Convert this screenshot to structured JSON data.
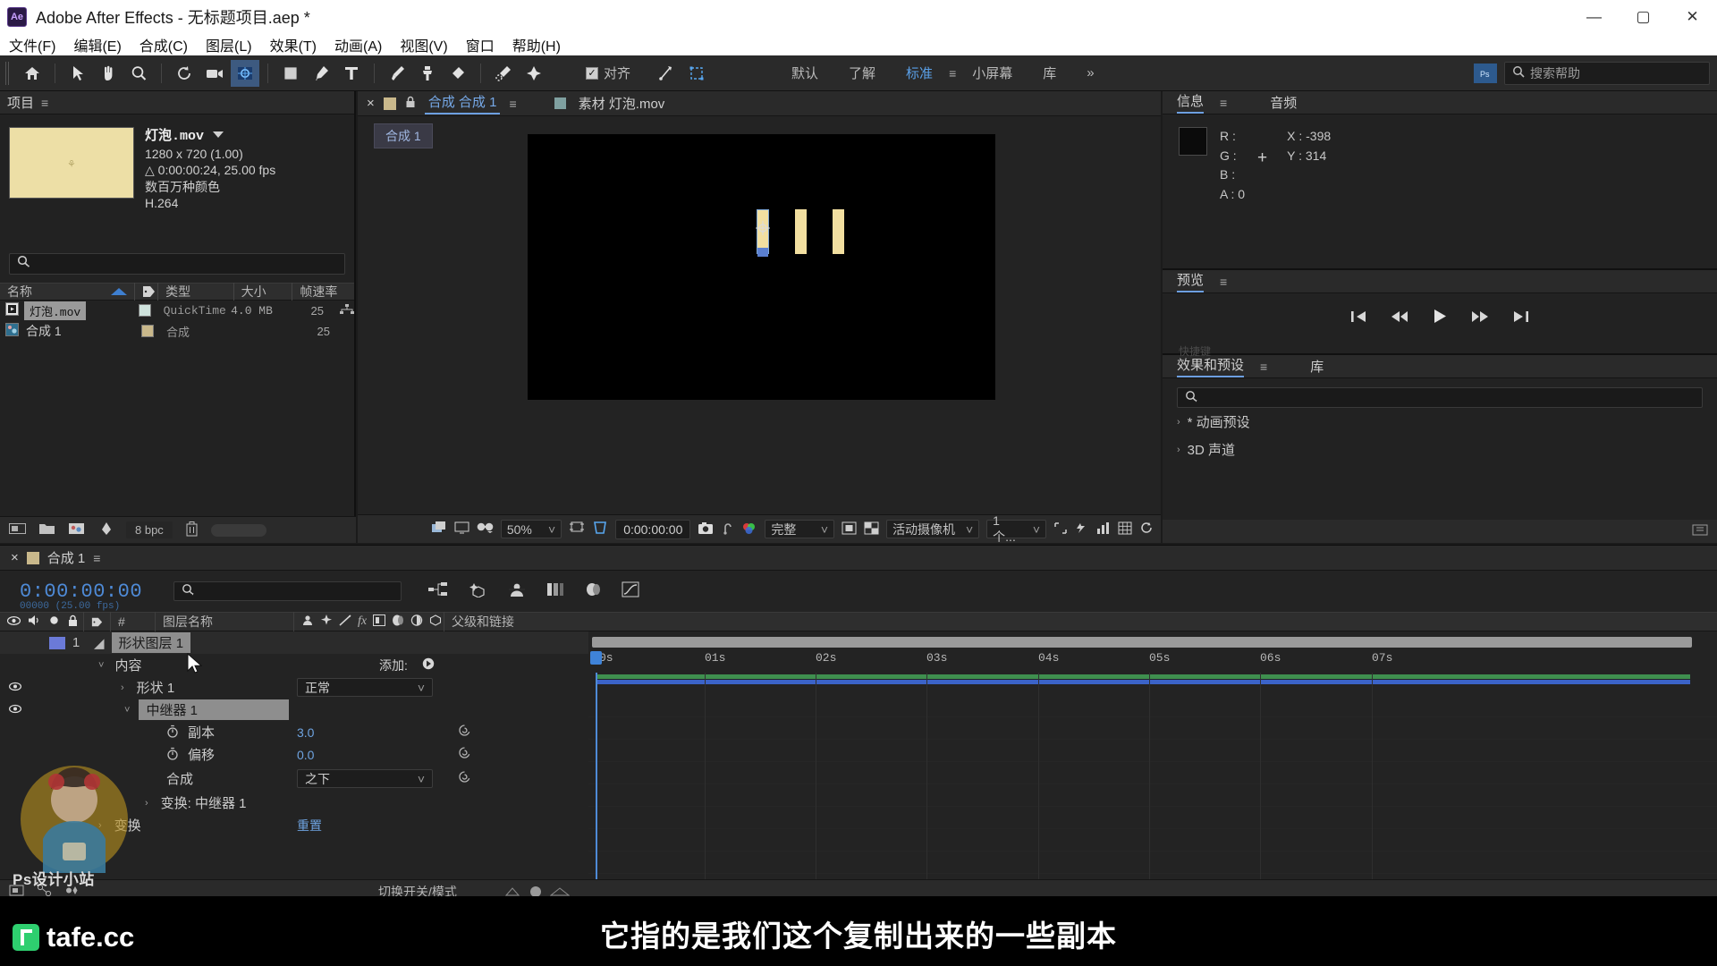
{
  "window": {
    "title": "Adobe After Effects - 无标题项目.aep *",
    "logo": "Ae",
    "minimize": "—",
    "maximize": "▢",
    "close": "✕"
  },
  "menubar": [
    "文件(F)",
    "编辑(E)",
    "合成(C)",
    "图层(L)",
    "效果(T)",
    "动画(A)",
    "视图(V)",
    "窗口",
    "帮助(H)"
  ],
  "toolbar": {
    "tools": [
      {
        "name": "home-icon"
      },
      {
        "name": "selection-tool-icon"
      },
      {
        "name": "hand-tool-icon"
      },
      {
        "name": "zoom-tool-icon"
      },
      {
        "name": "rotation-tool-icon"
      },
      {
        "name": "camera-tool-icon"
      },
      {
        "name": "unified-camera-tool-icon"
      },
      {
        "name": "shape-tool-icon"
      },
      {
        "name": "pen-tool-icon"
      },
      {
        "name": "type-tool-icon"
      },
      {
        "name": "brush-tool-icon"
      },
      {
        "name": "clone-stamp-tool-icon"
      },
      {
        "name": "eraser-tool-icon"
      },
      {
        "name": "roto-brush-tool-icon"
      },
      {
        "name": "puppet-tool-icon"
      }
    ],
    "snap_label": "对齐",
    "snap_checked": "✓",
    "workspaces": [
      "默认",
      "了解",
      "标准",
      "小屏幕",
      "库"
    ],
    "active_workspace": "标准",
    "overflow": "»",
    "search_placeholder": "搜索帮助"
  },
  "project": {
    "tab_label": "项目",
    "menu_icon": "≡",
    "asset": {
      "name": "灯泡.mov",
      "resolution": "1280 x 720 (1.00)",
      "duration": "△ 0:00:00:24, 25.00 fps",
      "colors": "数百万种颜色",
      "codec": "H.264"
    },
    "search_placeholder": "",
    "columns": [
      "名称",
      "类型",
      "大小",
      "帧速率"
    ],
    "rows": [
      {
        "name": "灯泡.mov",
        "type": "QuickTime",
        "size": "4.0 MB",
        "fps": "25",
        "selected": true
      },
      {
        "name": "合成 1",
        "type": "合成",
        "size": "",
        "fps": "25",
        "selected": false
      }
    ],
    "footer": {
      "bpc": "8 bpc"
    }
  },
  "viewer": {
    "tabs": [
      {
        "label": "合成 合成 1",
        "active": true,
        "close": "×",
        "lock": "🔒"
      },
      {
        "label": "素材 灯泡.mov",
        "active": false
      }
    ],
    "comp_chip": "合成 1",
    "footer": {
      "zoom": "50%",
      "timecode": "0:00:00:00",
      "quality": "完整",
      "camera": "活动摄像机",
      "views": "1 个..."
    }
  },
  "info_panel": {
    "tabs": [
      "信息",
      "音频"
    ],
    "active_tab": "信息",
    "channels": [
      "R :",
      "G :",
      "B :",
      "A : 0"
    ],
    "x_label": "X : -398",
    "y_label": "Y : 314",
    "plus": "+"
  },
  "preview_panel": {
    "tab": "预览",
    "menu_icon": "≡",
    "controls": [
      "first-frame",
      "prev-frame",
      "play",
      "next-frame",
      "last-frame"
    ],
    "shortcut_hint": "快捷键"
  },
  "effects_panel": {
    "tabs": [
      "效果和预设",
      "库"
    ],
    "active_tab": "效果和预设",
    "search_placeholder": "",
    "items": [
      "* 动画预设",
      "3D 声道"
    ]
  },
  "timeline": {
    "tab_label": "合成 1",
    "close": "×",
    "menu_icon": "≡",
    "current_time": "0:00:00:00",
    "time_sub": "00000 (25.00 fps)",
    "search_placeholder": "",
    "columns": {
      "hash": "#",
      "layer_name": "图层名称",
      "parent": "父级和链接"
    },
    "rows": [
      {
        "indent": 0,
        "label": "形状图层 1",
        "kind": "layer",
        "value": "",
        "hidden": true
      },
      {
        "indent": 1,
        "label": "内容",
        "kind": "group",
        "value": "添加:",
        "twirl": "˅",
        "eye": false
      },
      {
        "indent": 2,
        "label": "形状 1",
        "kind": "group",
        "value": "正常",
        "twirl": "›",
        "eye": true
      },
      {
        "indent": 2,
        "label": "中继器 1",
        "kind": "group-selected",
        "value": "",
        "twirl": "˅",
        "eye": true
      },
      {
        "indent": 3,
        "label": "副本",
        "kind": "prop",
        "value": "3.0",
        "stopwatch": true
      },
      {
        "indent": 3,
        "label": "偏移",
        "kind": "prop",
        "value": "0.0",
        "stopwatch": true
      },
      {
        "indent": 3,
        "label": "合成",
        "kind": "dropdown",
        "value": "之下"
      },
      {
        "indent": 2,
        "label": "变换: 中继器 1",
        "kind": "group",
        "value": "",
        "twirl": "›"
      },
      {
        "indent": 1,
        "label": "变换",
        "kind": "group",
        "value": "重置",
        "twirl": "›"
      }
    ],
    "ruler_ticks": [
      "0s",
      "01s",
      "02s",
      "03s",
      "04s",
      "05s",
      "06s",
      "07s"
    ],
    "footer_label": "切换开关/模式"
  },
  "branding": {
    "site": "tafe.cc",
    "watermark_text": "Ps设计小站"
  },
  "subtitle": "它指的是我们这个复制出来的一些副本",
  "colors": {
    "accent_blue": "#4e8ad6",
    "panel_bg": "#222222",
    "toolbar_bg": "#2a2a2a",
    "asset_yellow": "#f2dfa0",
    "selection_gray": "#8e8e8e",
    "green_bar": "#3f8f4f",
    "blue_bar": "#3b63c8"
  }
}
